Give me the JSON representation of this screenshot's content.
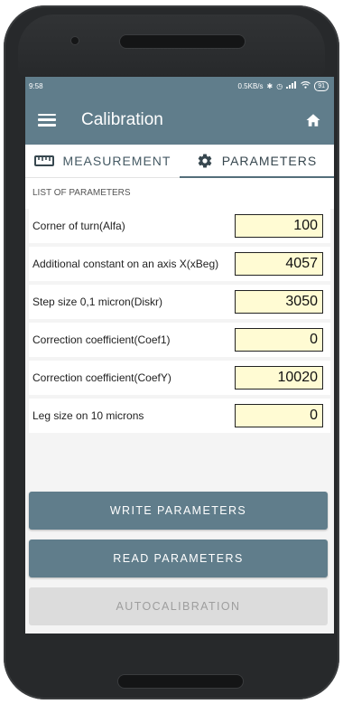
{
  "status_bar": {
    "time": "9:58",
    "network_speed": "0.5KB/s",
    "icons": [
      "bluetooth-icon",
      "alarm-icon",
      "signal-icon",
      "wifi-icon",
      "battery-icon"
    ],
    "battery": "91"
  },
  "toolbar": {
    "title": "Calibration",
    "menu_icon": "hamburger-menu-icon",
    "home_icon": "home-icon",
    "color": "#607d8b"
  },
  "tabs": [
    {
      "label": "MEASUREMENT",
      "icon": "ruler-icon",
      "active": false
    },
    {
      "label": "PARAMETERS",
      "icon": "gear-icon",
      "active": true
    }
  ],
  "section": {
    "title": "LIST OF PARAMETERS"
  },
  "parameters": [
    {
      "label": "Corner of turn(Alfa)",
      "value": "100"
    },
    {
      "label": "Additional constant on an axis X(xBeg)",
      "value": "4057"
    },
    {
      "label": "Step size 0,1 micron(Diskr)",
      "value": "3050"
    },
    {
      "label": "Correction coefficient(Coef1)",
      "value": "0"
    },
    {
      "label": "Correction coefficient(CoefY)",
      "value": "10020"
    },
    {
      "label": "Leg size on 10 microns",
      "value": "0"
    }
  ],
  "buttons": {
    "write": "WRITE PARAMETERS",
    "read": "READ PARAMETERS",
    "autocalibration": "AUTOCALIBRATION"
  },
  "colors": {
    "accent": "#607d8b",
    "input_background": "#fffbd3",
    "disabled_button": "#dcdcdc"
  }
}
